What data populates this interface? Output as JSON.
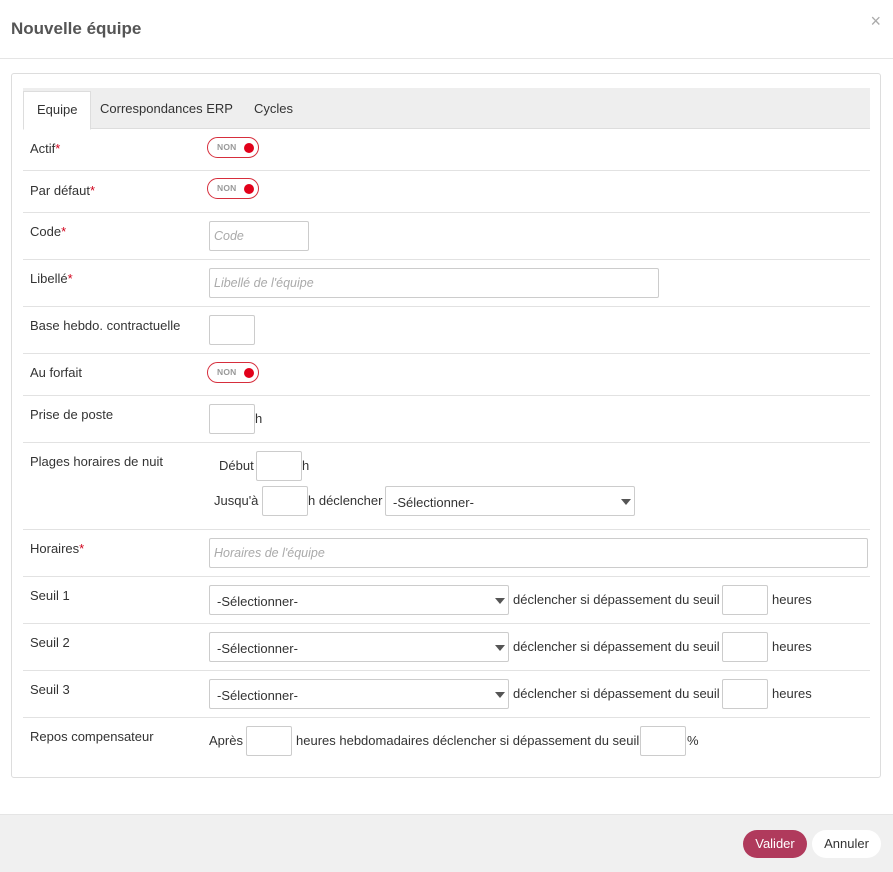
{
  "modal": {
    "title": "Nouvelle équipe",
    "close_glyph": "×"
  },
  "tabs": [
    "Equipe",
    "Correspondances ERP",
    "Cycles"
  ],
  "toggle_label": "NON",
  "fields": {
    "actif": {
      "label": "Actif",
      "required": "*"
    },
    "par_defaut": {
      "label": "Par défaut",
      "required": "*"
    },
    "code": {
      "label": "Code",
      "required": "*",
      "placeholder": "Code"
    },
    "libelle": {
      "label": "Libellé",
      "required": "*",
      "placeholder": "Libellé de l'équipe"
    },
    "base_hebdo": {
      "label": "Base hebdo. contractuelle"
    },
    "au_forfait": {
      "label": "Au forfait"
    },
    "prise_de_poste": {
      "label": "Prise de poste",
      "unit": "h"
    },
    "plages_nuit": {
      "label": "Plages horaires de nuit",
      "debut_label": "Début",
      "debut_unit": "h",
      "jusqua_label": "Jusqu'à",
      "jusqua_unit": "h déclencher",
      "select_value": "-Sélectionner-"
    },
    "horaires": {
      "label": "Horaires",
      "required": "*",
      "placeholder": "Horaires de l'équipe"
    },
    "seuils": [
      {
        "label": "Seuil 1",
        "select_value": "-Sélectionner-",
        "trigger_text": "déclencher si dépassement du seuil",
        "unit": "heures"
      },
      {
        "label": "Seuil 2",
        "select_value": "-Sélectionner-",
        "trigger_text": "déclencher si dépassement du seuil",
        "unit": "heures"
      },
      {
        "label": "Seuil 3",
        "select_value": "-Sélectionner-",
        "trigger_text": "déclencher si dépassement du seuil",
        "unit": "heures"
      }
    ],
    "repos": {
      "label": "Repos compensateur",
      "prefix": "Après",
      "middle": "heures hebdomadaires déclencher si dépassement du seuil",
      "suffix": "%"
    }
  },
  "footer": {
    "validate_label": "Valider",
    "cancel_label": "Annuler"
  },
  "colors": {
    "primary": "#b03a5c",
    "toggle_red": "#e2001a"
  }
}
